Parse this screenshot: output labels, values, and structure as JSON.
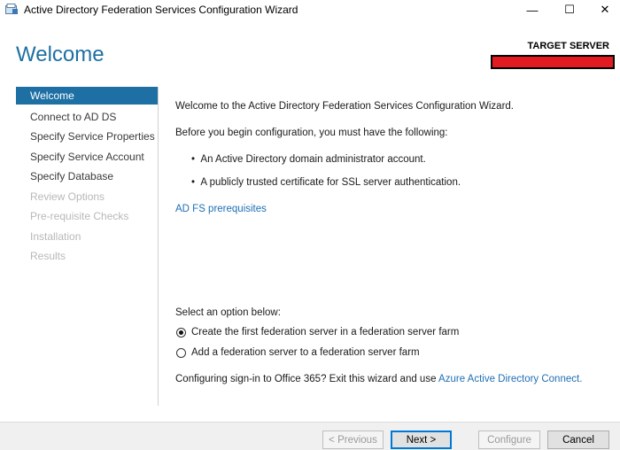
{
  "window": {
    "title": "Active Directory Federation Services Configuration Wizard",
    "minimize": "—",
    "maximize": "☐",
    "close": "✕"
  },
  "header": {
    "page_title": "Welcome",
    "target_label": "TARGET SERVER"
  },
  "sidebar": {
    "items": [
      {
        "label": "Welcome",
        "state": "active"
      },
      {
        "label": "Connect to AD DS",
        "state": "enabled"
      },
      {
        "label": "Specify Service Properties",
        "state": "enabled"
      },
      {
        "label": "Specify Service Account",
        "state": "enabled"
      },
      {
        "label": "Specify Database",
        "state": "enabled"
      },
      {
        "label": "Review Options",
        "state": "disabled"
      },
      {
        "label": "Pre-requisite Checks",
        "state": "disabled"
      },
      {
        "label": "Installation",
        "state": "disabled"
      },
      {
        "label": "Results",
        "state": "disabled"
      }
    ]
  },
  "main": {
    "intro": "Welcome to the Active Directory Federation Services Configuration Wizard.",
    "before": "Before you begin configuration, you must have the following:",
    "bullets": [
      "An Active Directory domain administrator account.",
      "A publicly trusted certificate for SSL server authentication."
    ],
    "prereq_link": "AD FS prerequisites",
    "select_label": "Select an option below:",
    "options": [
      {
        "label": "Create the first federation server in a federation server farm",
        "selected": true
      },
      {
        "label": "Add a federation server to a federation server farm",
        "selected": false
      }
    ],
    "office_text": "Configuring sign-in to Office 365? Exit this wizard and use ",
    "office_link": "Azure Active Directory Connect."
  },
  "footer": {
    "previous": "< Previous",
    "next": "Next >",
    "configure": "Configure",
    "cancel": "Cancel"
  },
  "colors": {
    "accent": "#1e6fa3",
    "redaction": "#e21b23"
  }
}
